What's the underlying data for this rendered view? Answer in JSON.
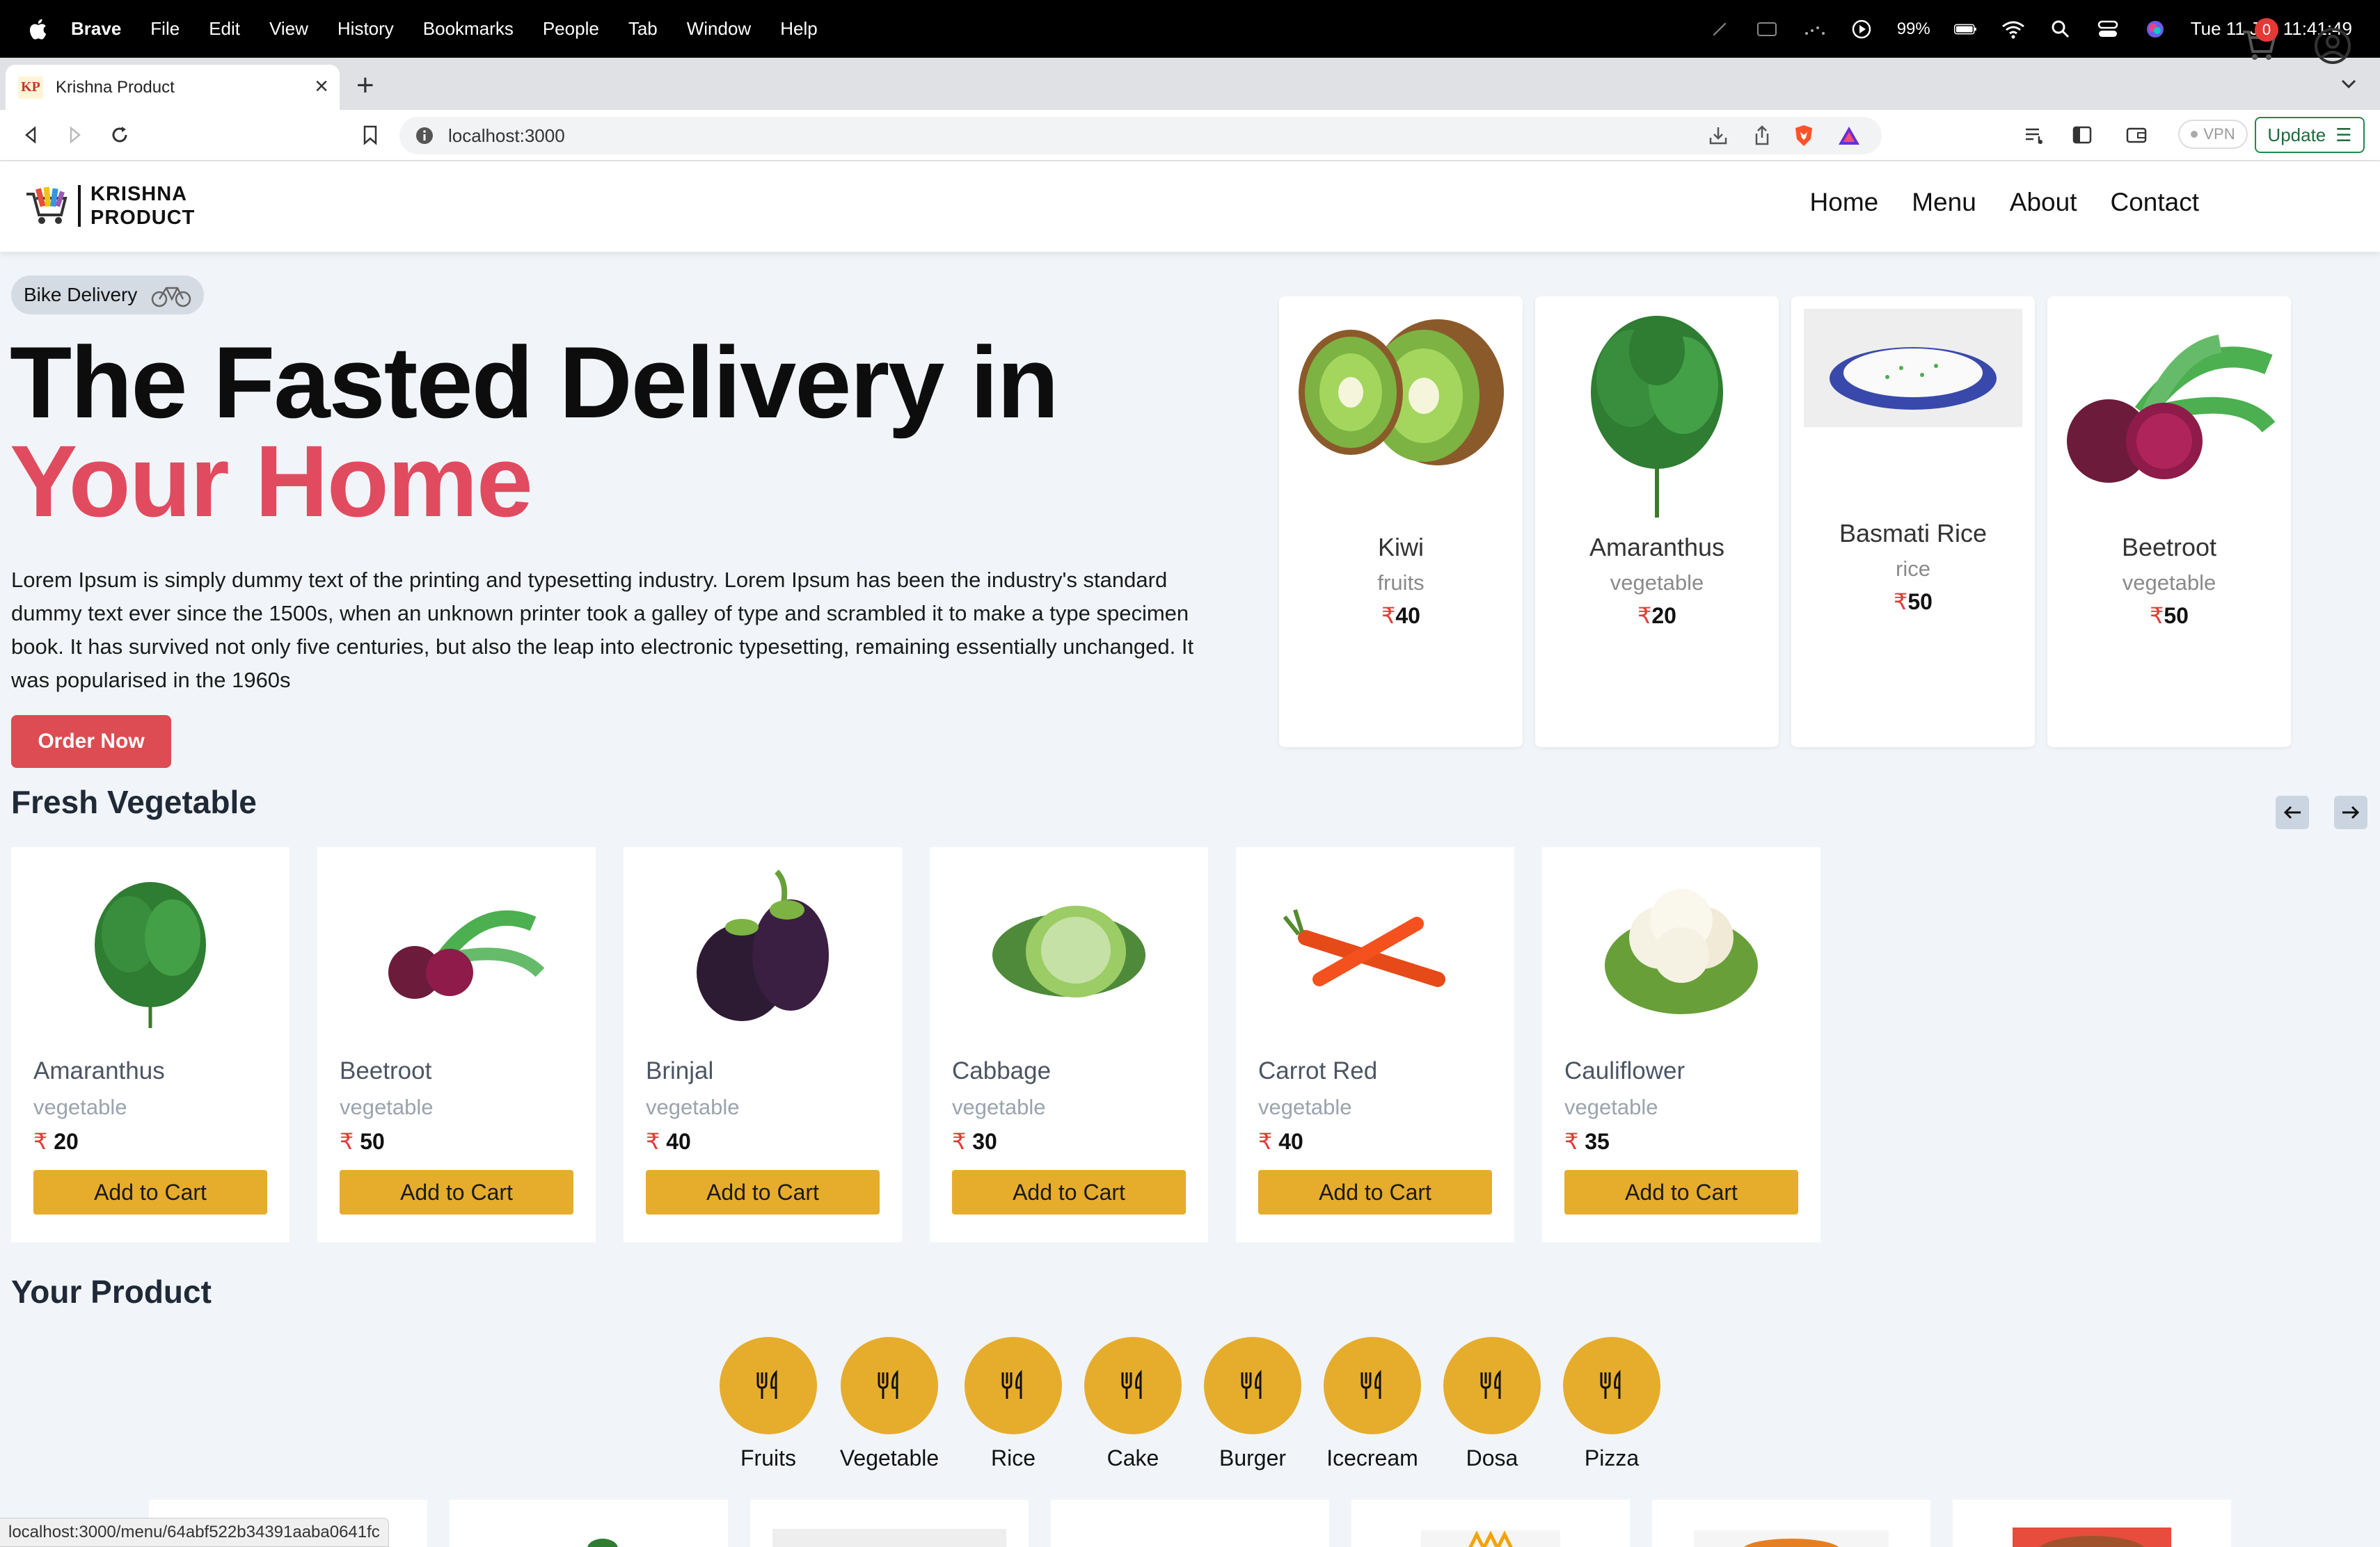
{
  "menubar": {
    "app": "Brave",
    "items": [
      "File",
      "Edit",
      "View",
      "History",
      "Bookmarks",
      "People",
      "Tab",
      "Window",
      "Help"
    ],
    "battery": "99%",
    "datetime": "Tue 11 Jul  11:41:49"
  },
  "browser": {
    "tab_title": "Krishna Product",
    "tab_favicon": "KP",
    "url": "localhost:3000",
    "vpn_label": "VPN",
    "update_label": "Update",
    "status_url": "localhost:3000/menu/64abf522b34391aaba0641fc"
  },
  "site": {
    "logo_line1": "KRISHNA",
    "logo_line2": "PRODUCT",
    "nav": [
      "Home",
      "Menu",
      "About",
      "Contact"
    ],
    "cart_count": "0"
  },
  "hero": {
    "badge": "Bike Delivery",
    "title_line1": "The Fasted Delivery in",
    "title_line2": "Your Home",
    "description": "Lorem Ipsum is simply dummy text of the printing and typesetting industry. Lorem Ipsum has been the industry's standard dummy text ever since the 1500s, when an unknown printer took a galley of type and scrambled it to make a type specimen book. It has survived not only five centuries, but also the leap into electronic typesetting, remaining essentially unchanged. It was popularised in the 1960s",
    "button": "Order Now",
    "cards": [
      {
        "name": "Kiwi",
        "category": "fruits",
        "price": "40",
        "icon": "kiwi-image"
      },
      {
        "name": "Amaranthus",
        "category": "vegetable",
        "price": "20",
        "icon": "amaranthus-image"
      },
      {
        "name": "Basmati Rice",
        "category": "rice",
        "price": "50",
        "icon": "rice-image"
      },
      {
        "name": "Beetroot",
        "category": "vegetable",
        "price": "50",
        "icon": "beetroot-image"
      }
    ]
  },
  "fresh": {
    "title": "Fresh Vegetable",
    "button_label": "Add to Cart",
    "items": [
      {
        "name": "Amaranthus",
        "category": "vegetable",
        "price": "20"
      },
      {
        "name": "Beetroot",
        "category": "vegetable",
        "price": "50"
      },
      {
        "name": "Brinjal",
        "category": "vegetable",
        "price": "40"
      },
      {
        "name": "Cabbage",
        "category": "vegetable",
        "price": "30"
      },
      {
        "name": "Carrot Red",
        "category": "vegetable",
        "price": "40"
      },
      {
        "name": "Cauliflower",
        "category": "vegetable",
        "price": "35"
      }
    ]
  },
  "products": {
    "title": "Your Product",
    "categories": [
      "Fruits",
      "Vegetable",
      "Rice",
      "Cake",
      "Burger",
      "Icecream",
      "Dosa",
      "Pizza"
    ]
  },
  "currency": "₹",
  "colors": {
    "accent_red": "#e14b5f",
    "order_button": "#dc4c52",
    "yellow": "#e6ac2c"
  }
}
